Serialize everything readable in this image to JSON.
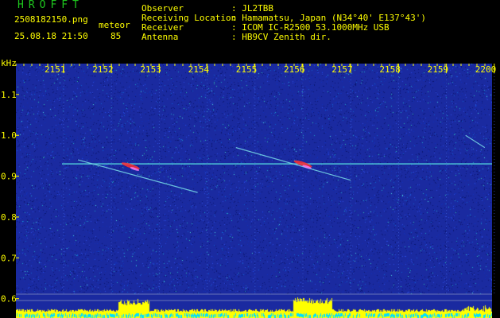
{
  "header": {
    "app_name": "HROFFT",
    "filename": "2508182150.png",
    "event_type": "meteor",
    "datetime": "25.08.18 21:50",
    "count": "85",
    "info": [
      {
        "label": "Observer",
        "value": ": JL2TBB"
      },
      {
        "label": "Receiving Location",
        "value": ": Hamamatsu, Japan (N34°40' E137°43')"
      },
      {
        "label": "Receiver",
        "value": ": ICOM IC-R2500 53.1000MHz USB"
      },
      {
        "label": "Antenna",
        "value": ": HB9CV Zenith dir."
      }
    ]
  },
  "colors": {
    "background": "#000000",
    "noise_base": "#1a2aa0",
    "text_yellow": "#ffff00",
    "title_green": "#1ec81e",
    "carrier": "#4ec8d8",
    "echo_hot": "#ff3030",
    "power_yellow": "#ffff00",
    "power_cyan": "#00e0ff"
  },
  "chart_data": {
    "type": "heatmap",
    "title": "",
    "xlabel": "",
    "ylabel": "kHz",
    "x_ticks": [
      "2151",
      "2152",
      "2153",
      "2154",
      "2155",
      "2156",
      "2157",
      "2158",
      "2159",
      "2200"
    ],
    "y_ticks": [
      "1.1",
      "1.0",
      "0.9",
      "0.8",
      "0.7",
      "0.6"
    ],
    "ylim": [
      0.58,
      1.16
    ],
    "xlim": [
      "2150",
      "2200"
    ],
    "carrier_khz": 0.93,
    "echoes": [
      {
        "start_time": "2151.5",
        "end_time": "2154.0",
        "f_start_khz": 0.94,
        "f_end_khz": 0.86,
        "peak_time": "2152.6",
        "peak_khz": 0.925
      },
      {
        "start_time": "2154.8",
        "end_time": "2157.2",
        "f_start_khz": 0.97,
        "f_end_khz": 0.89,
        "peak_time": "2156.2",
        "peak_khz": 0.93
      },
      {
        "start_time": "2159.6",
        "end_time": "2200",
        "f_start_khz": 1.0,
        "f_end_khz": 0.97,
        "peak_time": "",
        "peak_khz": null
      }
    ],
    "grid": true
  }
}
